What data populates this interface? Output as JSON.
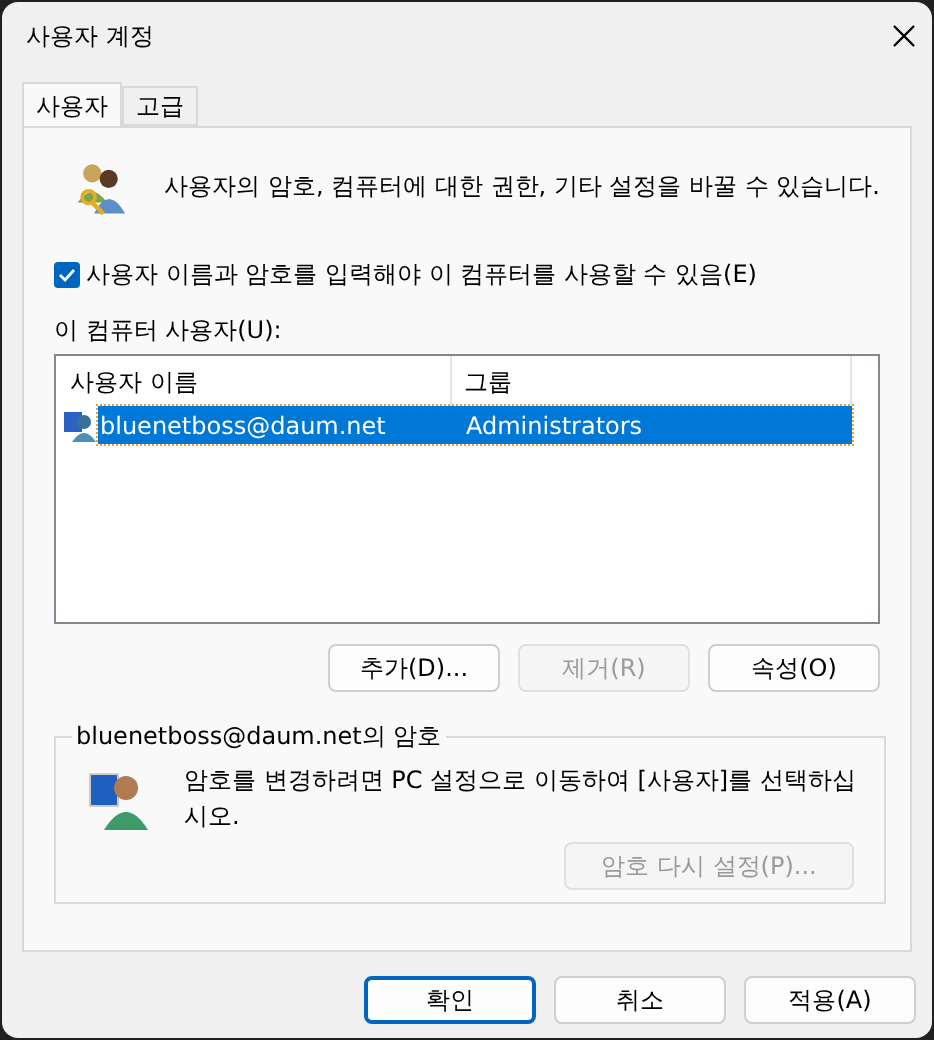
{
  "window": {
    "title": "사용자 계정"
  },
  "tabs": [
    {
      "label": "사용자",
      "selected": true
    },
    {
      "label": "고급",
      "selected": false
    }
  ],
  "description": "사용자의 암호, 컴퓨터에 대한 권한, 기타 설정을 바꿀 수 있습니다.",
  "login_required": {
    "label": "사용자 이름과 암호를 입력해야 이 컴퓨터를 사용할 수 있음(E)",
    "checked": true
  },
  "users_label": "이 컴퓨터 사용자(U):",
  "table": {
    "columns": [
      "사용자 이름",
      "그룹"
    ],
    "rows": [
      {
        "cells": [
          "bluenetboss@daum.net",
          "Administrators"
        ],
        "selected": true
      }
    ]
  },
  "user_buttons": [
    {
      "label": "추가(D)...",
      "disabled": false
    },
    {
      "label": "제거(R)",
      "disabled": true
    },
    {
      "label": "속성(O)",
      "disabled": false
    }
  ],
  "password_group": {
    "title": "bluenetboss@daum.net의 암호",
    "text": "암호를 변경하려면 PC 설정으로 이동하여 [사용자]를 선택하십시오.",
    "button": {
      "label": "암호 다시 설정(P)...",
      "disabled": true
    }
  },
  "footer_buttons": [
    {
      "label": "확인",
      "default": true
    },
    {
      "label": "취소",
      "default": false
    },
    {
      "label": "적용(A)",
      "default": false
    }
  ]
}
